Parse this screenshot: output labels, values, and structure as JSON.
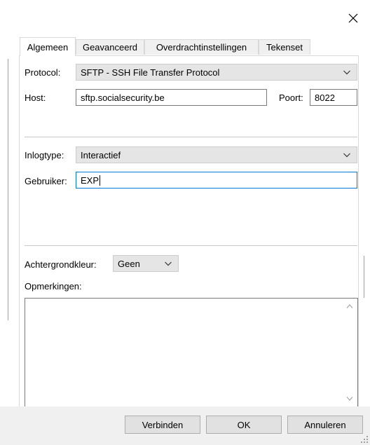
{
  "window": {
    "close_icon": "close-icon"
  },
  "tabs": [
    {
      "label": "Algemeen",
      "active": true
    },
    {
      "label": "Geavanceerd",
      "active": false
    },
    {
      "label": "Overdrachtinstellingen",
      "active": false
    },
    {
      "label": "Tekenset",
      "active": false
    }
  ],
  "general": {
    "protocol_label": "Protocol:",
    "protocol_value": "SFTP - SSH File Transfer Protocol",
    "host_label": "Host:",
    "host_value": "sftp.socialsecurity.be",
    "port_label": "Poort:",
    "port_value": "8022",
    "logontype_label": "Inlogtype:",
    "logontype_value": "Interactief",
    "user_label": "Gebruiker:",
    "user_value": "EXP",
    "bgcolor_label": "Achtergrondkleur:",
    "bgcolor_value": "Geen",
    "comments_label": "Opmerkingen:",
    "comments_value": ""
  },
  "footer": {
    "connect_label": "Verbinden",
    "ok_label": "OK",
    "cancel_label": "Annuleren"
  },
  "colors": {
    "focus_border": "#0078d7",
    "combo_bg": "#e5e5e5",
    "footer_bg": "#f0f0f0"
  }
}
